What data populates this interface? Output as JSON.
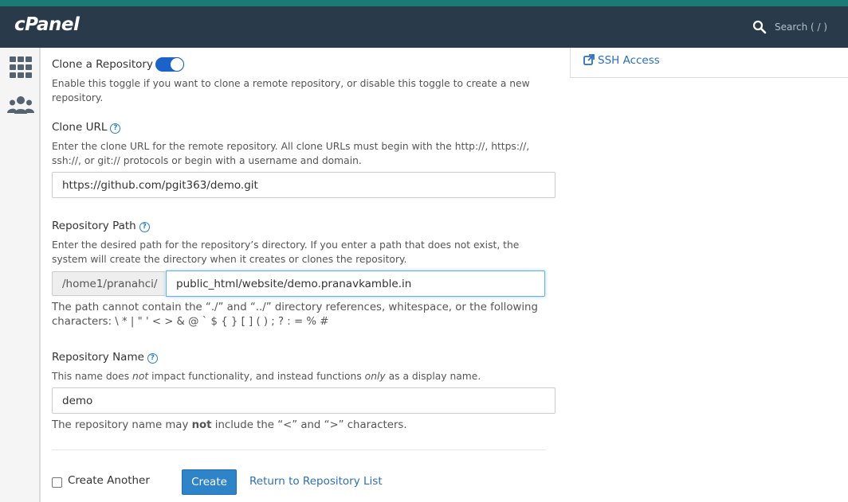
{
  "header": {
    "logo": "cPanel",
    "search_placeholder": "Search ( / )"
  },
  "sidebar": {
    "icons": [
      "grid-icon",
      "users-icon"
    ]
  },
  "form": {
    "clone": {
      "label": "Clone a Repository",
      "enabled": true,
      "description": "Enable this toggle if you want to clone a remote repository, or disable this toggle to create a new repository."
    },
    "clone_url": {
      "label": "Clone URL",
      "description": "Enter the clone URL for the remote repository. All clone URLs must begin with the http://, https://, ssh://, or git:// protocols or begin with a username and domain.",
      "value": "https://github.com/pgit363/demo.git"
    },
    "repo_path": {
      "label": "Repository Path",
      "description": "Enter the desired path for the repository’s directory. If you enter a path that does not exist, the system will create the directory when it creates or clones the repository.",
      "prefix": "/home1/pranahci/",
      "value": "public_html/website/demo.pranavkamble.in",
      "note": "The path cannot contain the “./” and “../” directory references, whitespace, or the following characters: \\ * | \" ' < > & @ ` $ { } [ ] ( ) ; ? : = % #"
    },
    "repo_name": {
      "label": "Repository Name",
      "description_pre": "This name does ",
      "description_em1": "not",
      "description_mid": " impact functionality, and instead functions ",
      "description_em2": "only",
      "description_post": " as a display name.",
      "value": "demo",
      "note_pre": "The repository name may ",
      "note_strong": "not",
      "note_post": " include the “<” and “>” characters."
    },
    "create_another_label": "Create Another",
    "create_button": "Create",
    "return_link": "Return to Repository List"
  },
  "right_panel": {
    "ssh_link": "SSH Access"
  },
  "colors": {
    "header_bg": "#293a4a",
    "accent": "#1b62c9",
    "button": "#2f83c9",
    "link": "#2d6fb5"
  }
}
